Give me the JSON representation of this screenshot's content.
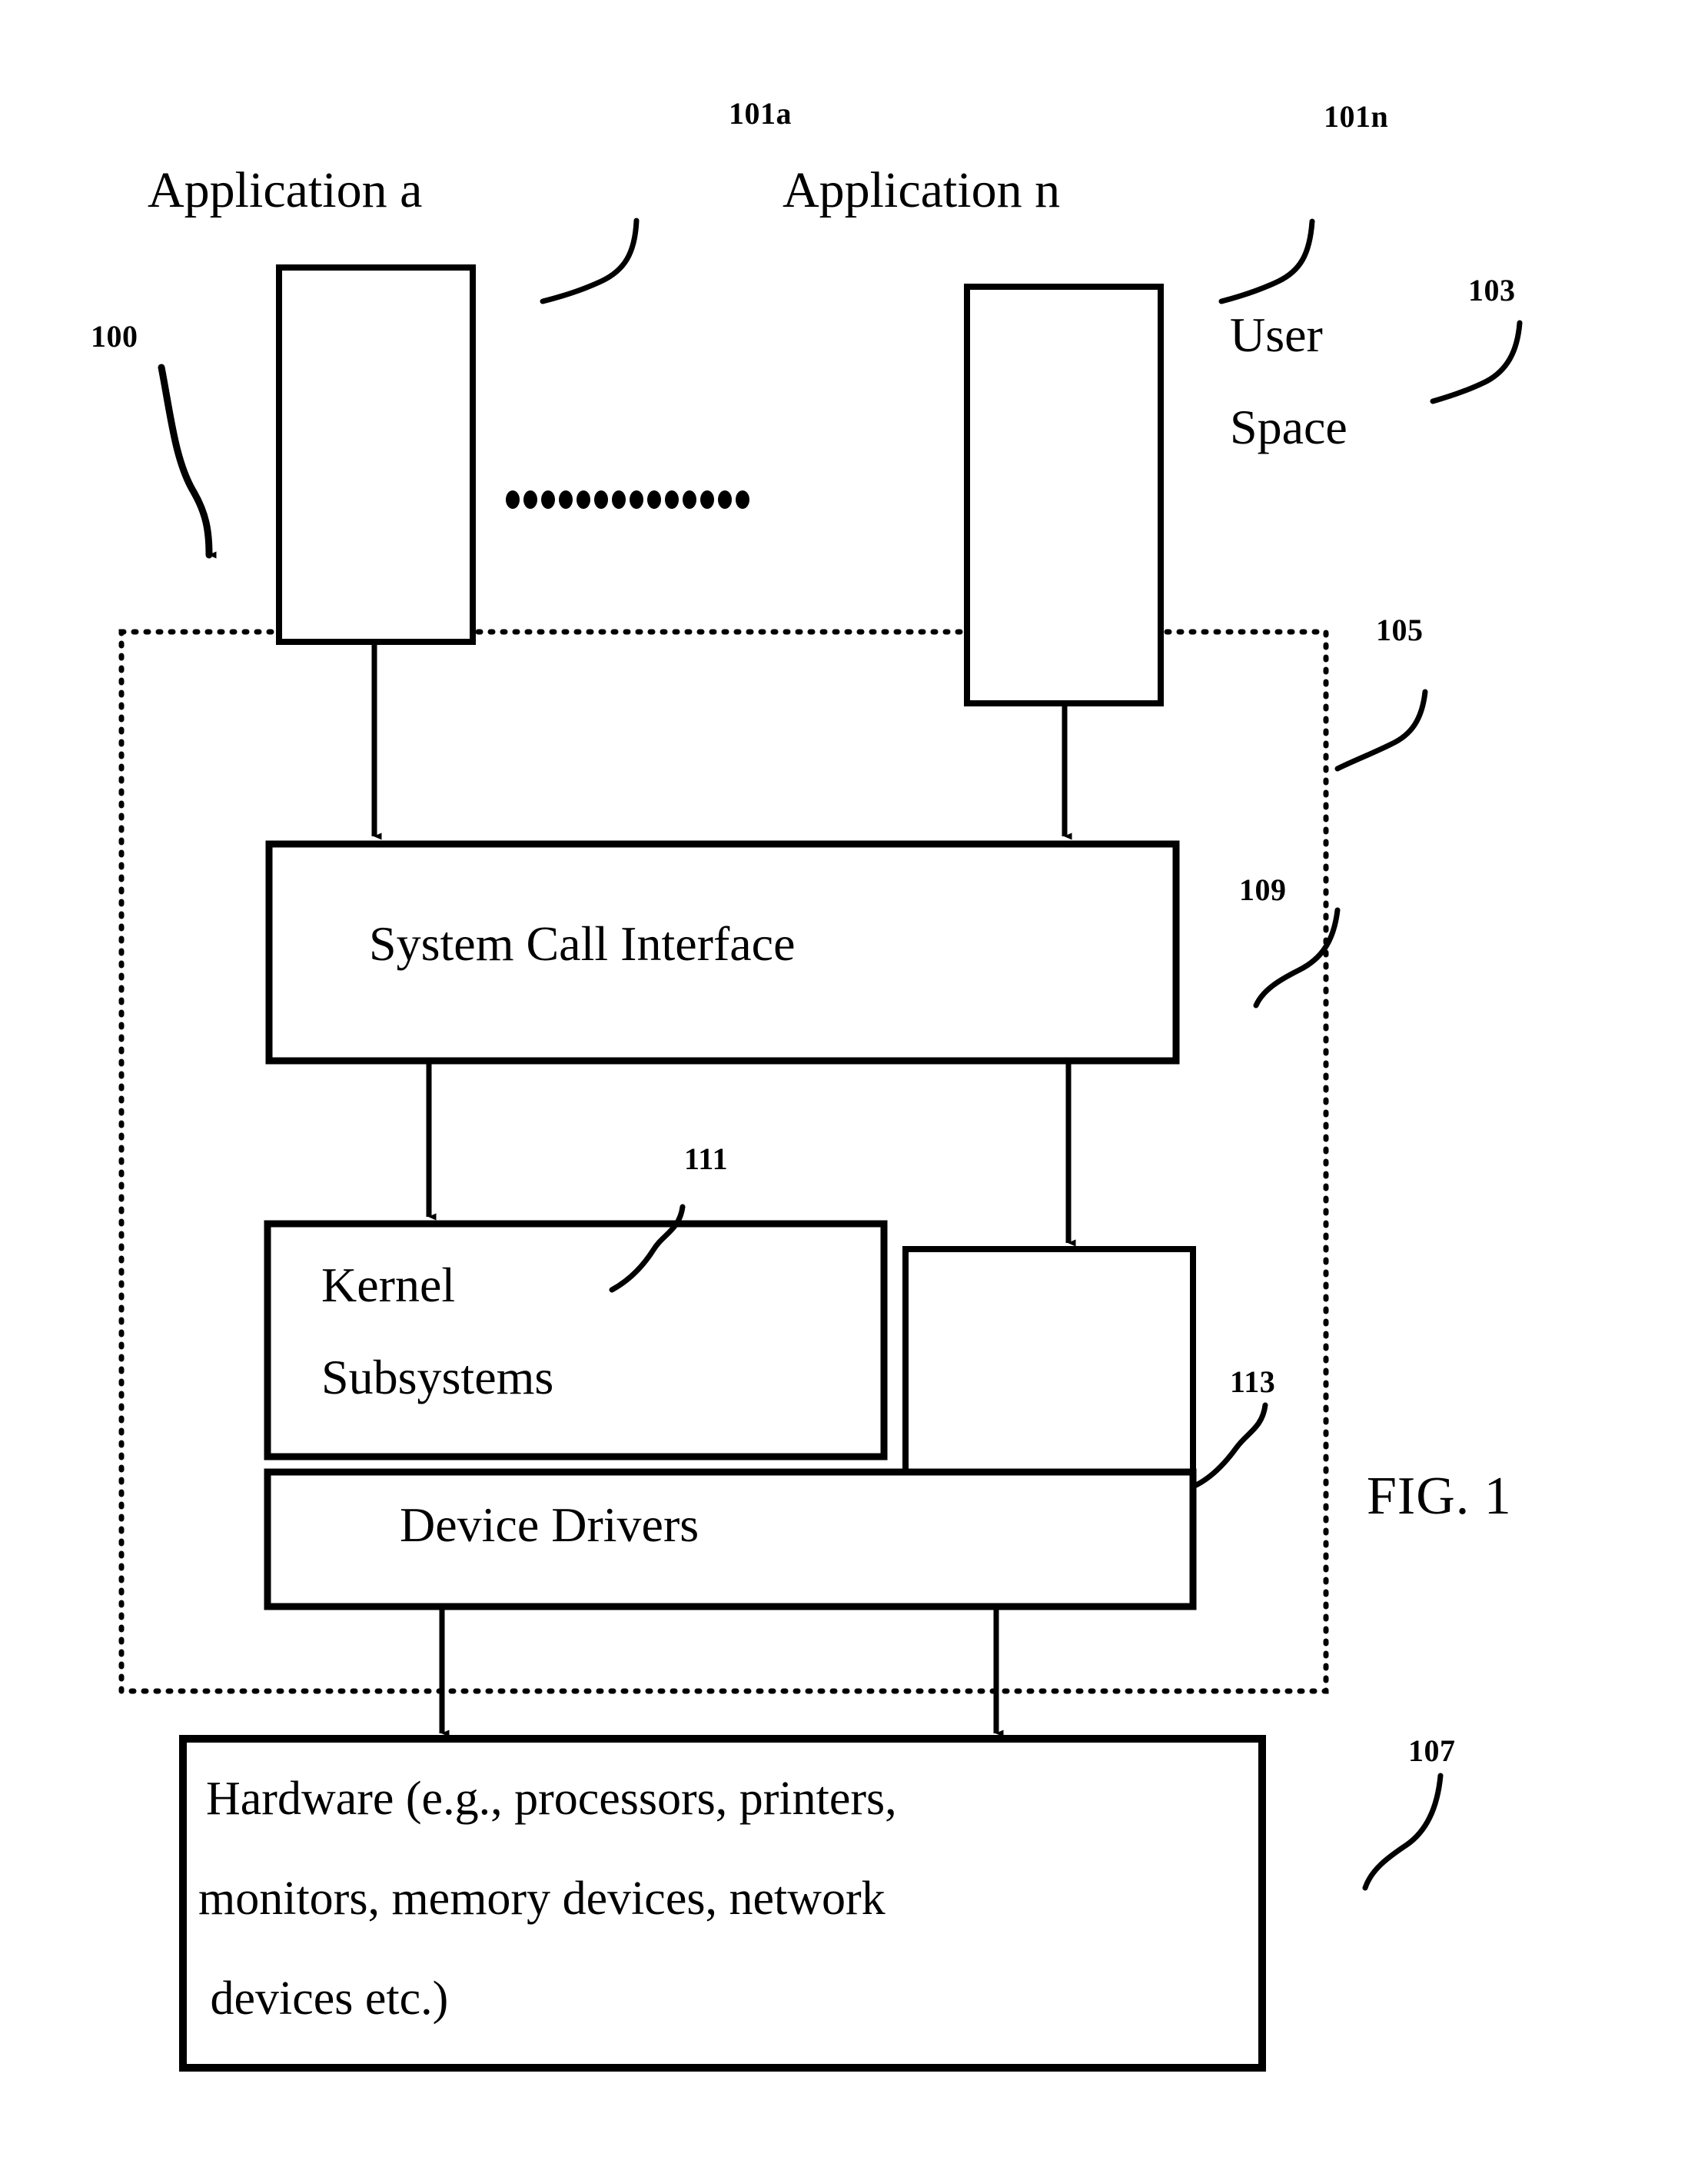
{
  "figure": {
    "caption": "FIG. 1",
    "system_numeral": "100"
  },
  "applications": [
    {
      "title": "Application a",
      "numeral": "101a"
    },
    {
      "title": "Application n",
      "numeral": "101n"
    }
  ],
  "ellipsis": {
    "glyph": "•",
    "dot_count": 15
  },
  "regions": [
    {
      "name": "user_space",
      "label_line1": "User",
      "label_line2": "Space",
      "numeral": "103"
    },
    {
      "name": "kernel_space",
      "numeral": "105"
    }
  ],
  "blocks": [
    {
      "id": "system_call_interface",
      "label": "System Call Interface",
      "numeral": "109"
    },
    {
      "id": "kernel_subsystems",
      "label_line1": "Kernel",
      "label_line2": "Subsystems",
      "numeral": "111"
    },
    {
      "id": "kernel_module_right",
      "label": "",
      "numeral": "113"
    },
    {
      "id": "device_drivers",
      "label": "Device Drivers",
      "numeral": ""
    },
    {
      "id": "hardware",
      "label_line1": "Hardware (e.g., processors, printers,",
      "label_line2": "monitors, memory devices, network",
      "label_line3": " devices etc.)",
      "numeral": "107"
    }
  ],
  "colors": {
    "ink": "#000000",
    "background": "#ffffff"
  }
}
